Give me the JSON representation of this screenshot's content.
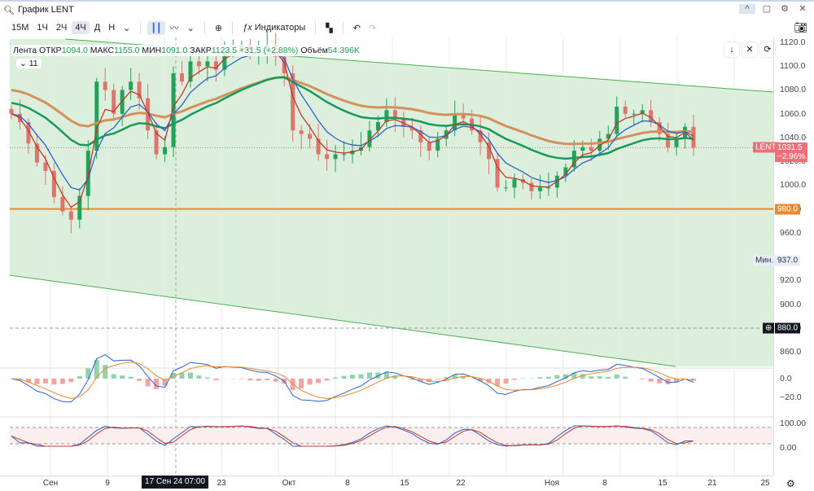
{
  "window": {
    "title": "График LENT",
    "icons": [
      "search-icon",
      "chevron-up-icon",
      "maximize-icon",
      "gear-icon",
      "close-icon"
    ]
  },
  "toolbar": {
    "intervals": [
      "15М",
      "1Ч",
      "2Ч",
      "4Ч",
      "Д",
      "Н"
    ],
    "active_interval": "4Ч",
    "indicators_label": "Индикаторы"
  },
  "legend": {
    "name": "Лента",
    "open_label": "ОТКР",
    "open": "1094.0",
    "high_label": "МАКС",
    "high": "1155.0",
    "low_label": "МИН",
    "low": "1091.0",
    "close_label": "ЗАКР",
    "close": "1123.5",
    "change": "+31.5 (+2.88%)",
    "volume_label": "Объём",
    "volume": "54.396K",
    "collapse_count": "11"
  },
  "price_axis": {
    "labels": [
      "1120.0",
      "1100.0",
      "1080.0",
      "1060.0",
      "1040.0",
      "1020.0",
      "1000.0",
      "980.0",
      "960.0",
      "920.0",
      "900.0",
      "880.0",
      "860.0"
    ],
    "last_tag": "LENT",
    "last_price": "1031.5",
    "last_change": "−2.96%",
    "level_980": "980.0",
    "min_label": "Мин.",
    "min_value": "937.0",
    "crosshair_price": "880.0"
  },
  "macd_axis": [
    "0.0",
    "−20.0"
  ],
  "stoch_axis": [
    "100.00",
    "0.00"
  ],
  "time_axis": {
    "labels": [
      "Сен",
      "9",
      "23",
      "Окт",
      "8",
      "15",
      "22",
      "Ноя",
      "8",
      "15",
      "21",
      "25"
    ],
    "crosshair": "17 Сен 24  07:00"
  },
  "colors": {
    "up": "#22a35a",
    "down": "#e0736c",
    "channel_fill": "#dcefdc",
    "channel_line": "#4caf50",
    "level": "#e8892c",
    "ma_blue": "#2d62c8",
    "ma_red": "#c0392b",
    "ma_green": "#1a9a5a",
    "ma_orange": "#d4915a"
  },
  "chart_data": {
    "type": "candlestick",
    "ylim": [
      850,
      1125
    ],
    "level": 980,
    "last": 1031.5,
    "closes": [
      1060,
      1053,
      1035,
      1019,
      1012,
      990,
      978,
      971,
      991,
      1029,
      1087,
      1080,
      1060,
      1080,
      1087,
      1073,
      1046,
      1026,
      1032,
      1094,
      1087,
      1104,
      1100,
      1104,
      1097,
      1114,
      1114,
      1118,
      1114,
      1114,
      1118,
      1108,
      1094,
      1046,
      1043,
      1039,
      1026,
      1022,
      1026,
      1026,
      1029,
      1032,
      1046,
      1053,
      1063,
      1056,
      1049,
      1046,
      1036,
      1029,
      1039,
      1046,
      1060,
      1056,
      1046,
      1036,
      1022,
      998,
      998,
      1005,
      1002,
      995,
      998,
      998,
      1008,
      1015,
      1029,
      1032,
      1029,
      1039,
      1043,
      1066,
      1060,
      1060,
      1063,
      1053,
      1043,
      1032,
      1039,
      1049,
      1031.5
    ]
  }
}
